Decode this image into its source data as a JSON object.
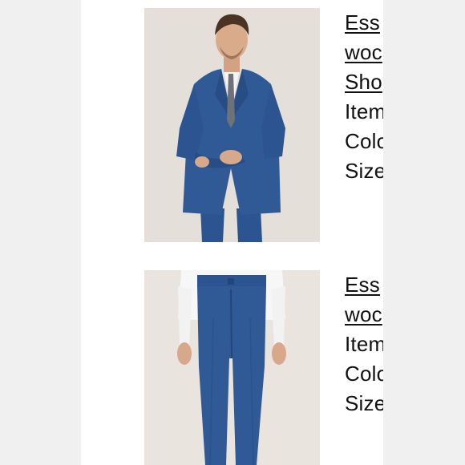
{
  "products": [
    {
      "title_line1": "Ess",
      "title_line2": "woc",
      "link3": "Sho",
      "item_label": "Item",
      "color_label": "Colo",
      "size_label": "Size",
      "image": "suit-jacket-model-photo",
      "colors": {
        "suit": "#2f5a96",
        "backdrop": "#e9e4dd"
      }
    },
    {
      "title_line1": "Ess",
      "title_line2": "woc",
      "item_label": "Item",
      "color_label": "Colo",
      "size_label": "Size",
      "image": "suit-trousers-model-photo",
      "colors": {
        "suit": "#2f5a96",
        "backdrop": "#e9e4dd"
      }
    }
  ]
}
